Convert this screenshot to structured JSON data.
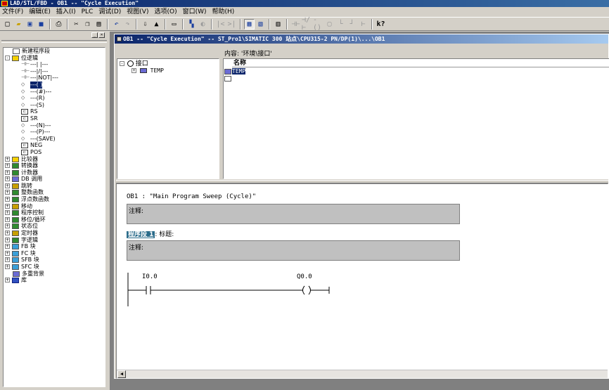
{
  "window": {
    "title": "LAD/STL/FBD  - OB1 -- \"Cycle Execution\""
  },
  "menu": [
    "文件(F)",
    "编辑(E)",
    "插入(I)",
    "PLC",
    "调试(D)",
    "视图(V)",
    "选项(O)",
    "窗口(W)",
    "帮助(H)"
  ],
  "toolbar": {
    "icons": [
      "new-icon",
      "open-icon",
      "accessible-nodes-icon",
      "save-icon",
      "print-icon",
      "cut-icon",
      "copy-icon",
      "paste-icon",
      "undo-icon",
      "redo-icon",
      "load-icon",
      "download-icon",
      "monitor-icon",
      "overview-icon",
      "toggle-icon",
      "back-icon",
      "forward-icon",
      "program-elements-icon",
      "details-icon",
      "new-network-icon",
      "normally-open-icon",
      "normally-closed-icon",
      "coil-icon",
      "empty-box-icon",
      "branch-open-icon",
      "branch-close-icon",
      "help-icon"
    ]
  },
  "catalog": {
    "items": [
      {
        "label": "新建程序段",
        "icon": "new-network-icon",
        "level": 1,
        "expander": ""
      },
      {
        "label": "位逻辑",
        "icon": "bit-logic-icon",
        "level": 0,
        "expander": "-"
      },
      {
        "label": "---|  |---",
        "icon": "no-contact-icon",
        "level": 2,
        "expander": ""
      },
      {
        "label": "---|/|---",
        "icon": "nc-contact-icon",
        "level": 2,
        "expander": ""
      },
      {
        "label": "---|NOT|---",
        "icon": "not-contact-icon",
        "level": 2,
        "expander": ""
      },
      {
        "label": "---( )",
        "icon": "coil-icon",
        "level": 2,
        "expander": ""
      },
      {
        "label": "---(#)---",
        "icon": "midline-coil-icon",
        "level": 2,
        "expander": ""
      },
      {
        "label": "---(R)",
        "icon": "reset-coil-icon",
        "level": 2,
        "expander": ""
      },
      {
        "label": "---(S)",
        "icon": "set-coil-icon",
        "level": 2,
        "expander": ""
      },
      {
        "label": "RS",
        "icon": "rs-box-icon",
        "level": 2,
        "expander": ""
      },
      {
        "label": "SR",
        "icon": "sr-box-icon",
        "level": 2,
        "expander": ""
      },
      {
        "label": "---(N)---",
        "icon": "neg-edge-coil-icon",
        "level": 2,
        "expander": ""
      },
      {
        "label": "---(P)---",
        "icon": "pos-edge-coil-icon",
        "level": 2,
        "expander": ""
      },
      {
        "label": "---(SAVE)",
        "icon": "save-coil-icon",
        "level": 2,
        "expander": ""
      },
      {
        "label": "NEG",
        "icon": "neg-box-icon",
        "level": 2,
        "expander": ""
      },
      {
        "label": "POS",
        "icon": "pos-box-icon",
        "level": 2,
        "expander": ""
      },
      {
        "label": "比较器",
        "icon": "comparator-icon",
        "level": 0,
        "expander": "+"
      },
      {
        "label": "转换器",
        "icon": "converter-icon",
        "level": 0,
        "expander": "+"
      },
      {
        "label": "计数器",
        "icon": "counter-icon",
        "level": 0,
        "expander": "+"
      },
      {
        "label": "DB 调用",
        "icon": "db-call-icon",
        "level": 0,
        "expander": "+"
      },
      {
        "label": "跳转",
        "icon": "jump-icon",
        "level": 0,
        "expander": "+"
      },
      {
        "label": "整数函数",
        "icon": "integer-math-icon",
        "level": 0,
        "expander": "+"
      },
      {
        "label": "浮点数函数",
        "icon": "float-math-icon",
        "level": 0,
        "expander": "+"
      },
      {
        "label": "移动",
        "icon": "move-icon",
        "level": 0,
        "expander": "+"
      },
      {
        "label": "程序控制",
        "icon": "program-control-icon",
        "level": 0,
        "expander": "+"
      },
      {
        "label": "移位/循环",
        "icon": "shift-rotate-icon",
        "level": 0,
        "expander": "+"
      },
      {
        "label": "状态位",
        "icon": "status-bits-icon",
        "level": 0,
        "expander": "+"
      },
      {
        "label": "定时器",
        "icon": "timer-icon",
        "level": 0,
        "expander": "+"
      },
      {
        "label": "字逻辑",
        "icon": "word-logic-icon",
        "level": 0,
        "expander": "+"
      },
      {
        "label": "FB 块",
        "icon": "fb-block-icon",
        "level": 0,
        "expander": "+"
      },
      {
        "label": "FC 块",
        "icon": "fc-block-icon",
        "level": 0,
        "expander": "+"
      },
      {
        "label": "SFB 块",
        "icon": "sfb-block-icon",
        "level": 0,
        "expander": "+"
      },
      {
        "label": "SFC 块",
        "icon": "sfc-block-icon",
        "level": 0,
        "expander": "+"
      },
      {
        "label": "多重背景",
        "icon": "multi-instance-icon",
        "level": 1,
        "expander": ""
      },
      {
        "label": "库",
        "icon": "libraries-icon",
        "level": 0,
        "expander": "+"
      }
    ]
  },
  "editor_window": {
    "title": "OB1 -- \"Cycle Execution\" -- ST_Pro1\\SIMATIC 300 站点\\CPU315-2 PN/DP(1)\\...\\OB1",
    "content_label": "内容: '环境\\接口'",
    "interface_tree": {
      "root": "接口",
      "child": "TEMP"
    },
    "interface_table": {
      "column": "名称",
      "rows": [
        "TEMP",
        ""
      ]
    },
    "block_title": "OB1 :  \"Main Program Sweep (Cycle)\"",
    "block_comment": "注释:",
    "network_label": "程序段 1",
    "network_title_suffix": ": 标题:",
    "network_comment": "注释:",
    "contact_address": "I0.0",
    "coil_address": "Q0.0"
  }
}
